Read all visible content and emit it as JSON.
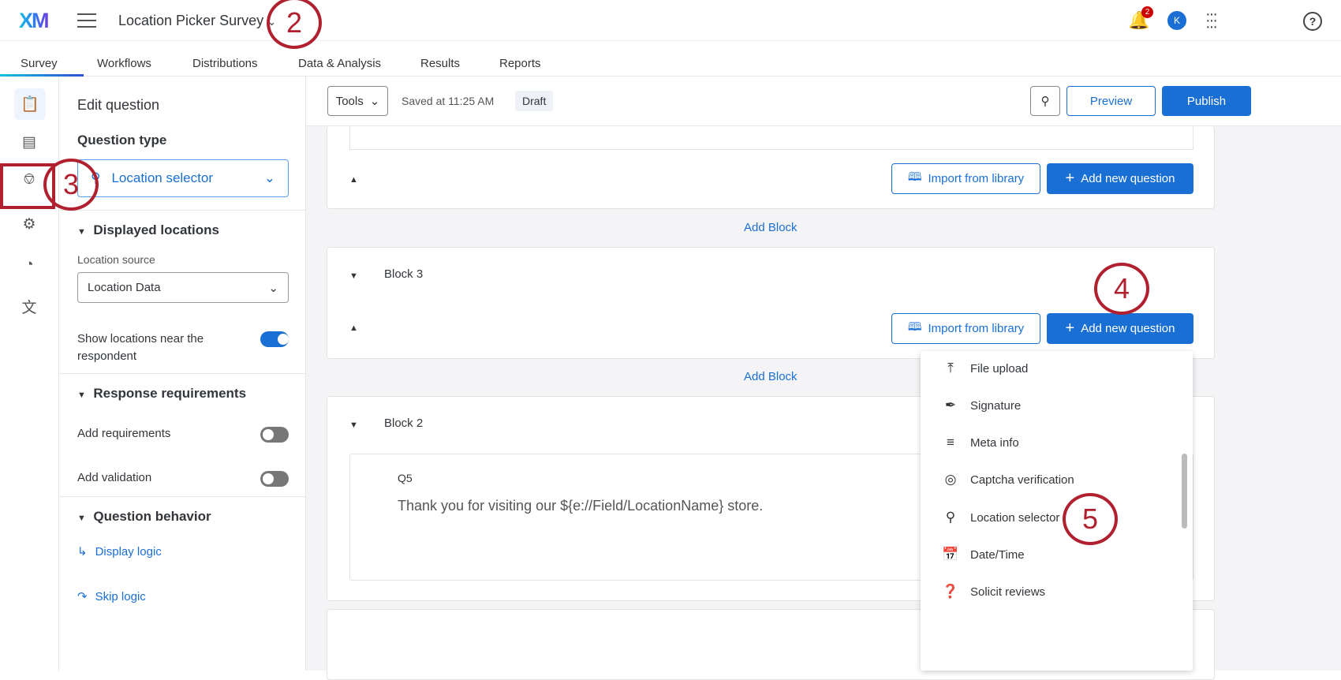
{
  "header": {
    "logo": "XM",
    "survey_title": "Location Picker Survey",
    "notification_count": "2",
    "avatar_initial": "K"
  },
  "tabs": [
    "Survey",
    "Workflows",
    "Distributions",
    "Data & Analysis",
    "Results",
    "Reports"
  ],
  "toolbar": {
    "tools": "Tools",
    "saved": "Saved at 11:25 AM",
    "status": "Draft",
    "preview": "Preview",
    "publish": "Publish"
  },
  "panel": {
    "heading": "Edit question",
    "question_type_label": "Question type",
    "question_type_value": "Location selector",
    "displayed_locations": "Displayed locations",
    "location_source_label": "Location source",
    "location_source_value": "Location Data",
    "show_near_label": "Show locations near the respondent",
    "show_near_on": true,
    "response_requirements": "Response requirements",
    "add_requirements": "Add requirements",
    "add_validation": "Add validation",
    "question_behavior": "Question behavior",
    "display_logic": "Display logic",
    "skip_logic": "Skip logic"
  },
  "blocks": {
    "import": "Import from library",
    "add_question": "Add new question",
    "add_block": "Add Block",
    "block3": "Block 3",
    "block2": "Block 2",
    "q5_id": "Q5",
    "q5_text": "Thank you for visiting our ${e://Field/LocationName} store."
  },
  "menu": [
    "File upload",
    "Signature",
    "Meta info",
    "Captcha verification",
    "Location selector",
    "Date/Time",
    "Solicit reviews"
  ],
  "annotations": [
    "2",
    "3",
    "4",
    "5"
  ],
  "colors": {
    "accent": "#1a6fd4",
    "annotation": "#b0202e"
  }
}
